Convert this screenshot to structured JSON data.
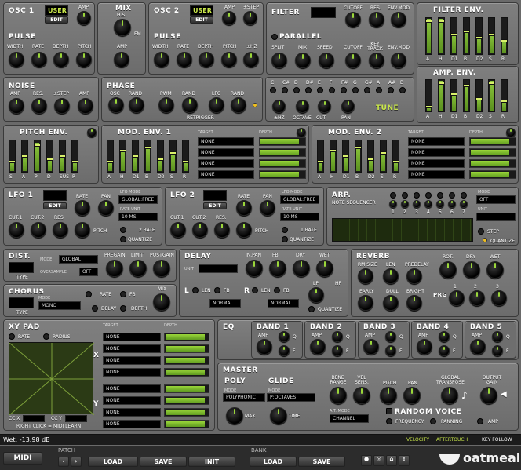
{
  "osc1": {
    "title": "OSC 1",
    "wave": "USER",
    "edit": "EDIT",
    "amp": "AMP",
    "pulse": "PULSE",
    "width": "WIDTH",
    "rate": "RATE",
    "depth": "DEPTH",
    "pitch": "PITCH"
  },
  "mix": {
    "title": "MIX",
    "hs": "H.S.",
    "fm": "FM",
    "amp": "AMP"
  },
  "osc2": {
    "title": "OSC 2",
    "wave": "USER",
    "edit": "EDIT",
    "amp": "AMP",
    "step": "±STEP",
    "pulse": "PULSE",
    "width": "WIDTH",
    "rate": "RATE",
    "depth": "DEPTH",
    "pitch": "PITCH",
    "hz": "±HZ"
  },
  "filter": {
    "title": "FILTER",
    "cutoff": "CUTOFF",
    "res": "RES.",
    "envmod": "ENV.MOD",
    "parallel": "PARALLEL",
    "split": "SPLIT",
    "mix": "MIX",
    "speed": "SPEED",
    "cutoff2": "CUTOFF",
    "keytrack": "KEY TRACK",
    "envmod2": "ENV.MOD"
  },
  "filterenv": {
    "title": "FILTER ENV.",
    "labels": [
      "A",
      "H",
      "D1",
      "B",
      "D2",
      "S",
      "R"
    ],
    "levels": [
      0.95,
      0.95,
      0.55,
      0.65,
      0.45,
      0.55,
      0.35
    ]
  },
  "ampenv": {
    "title": "AMP. ENV.",
    "labels": [
      "A",
      "H",
      "D1",
      "B",
      "D2",
      "S",
      "R"
    ],
    "levels": [
      0.1,
      0.95,
      0.55,
      0.85,
      0.4,
      0.95,
      0.3
    ]
  },
  "noise": {
    "title": "NOISE",
    "amp": "AMP",
    "res": "RES.",
    "step": "±STEP",
    "amp2": "AMP"
  },
  "phase": {
    "title": "PHASE",
    "osc": "OSC",
    "rand": "RAND",
    "pwm": "PWM",
    "rand2": "RAND",
    "lfo": "LFO",
    "rand3": "RAND",
    "retrigger": "RETRIGGER"
  },
  "tune": {
    "notes": [
      "C",
      "C#",
      "D",
      "D#",
      "E",
      "F",
      "F#",
      "G",
      "G#",
      "A",
      "A#",
      "B"
    ],
    "hz": "±HZ",
    "octave": "OCTAVE",
    "cut": "CUT",
    "pan": "PAN",
    "title": "TUNE"
  },
  "pitchenv": {
    "title": "PITCH ENV.",
    "labels": [
      "S",
      "A",
      "P",
      "D",
      "SUS",
      "R"
    ],
    "levels": [
      0.3,
      0.5,
      0.9,
      0.4,
      0.5,
      0.3
    ]
  },
  "modenv1": {
    "title": "MOD. ENV. 1",
    "target": "TARGET",
    "depth": "DEPTH",
    "labels": [
      "A",
      "H",
      "D1",
      "B",
      "D2",
      "S",
      "R"
    ],
    "levels": [
      0.3,
      0.7,
      0.5,
      0.8,
      0.4,
      0.6,
      0.3
    ],
    "rows": [
      "NONE",
      "NONE",
      "NONE",
      "NONE"
    ],
    "depths": [
      0.85,
      0.85,
      0.85,
      0.85
    ]
  },
  "modenv2": {
    "title": "MOD. ENV. 2",
    "target": "TARGET",
    "depth": "DEPTH",
    "labels": [
      "A",
      "H",
      "D1",
      "B",
      "D2",
      "S",
      "R"
    ],
    "levels": [
      0.3,
      0.7,
      0.5,
      0.8,
      0.4,
      0.6,
      0.3
    ],
    "rows": [
      "NONE",
      "NONE",
      "NONE",
      "NONE"
    ],
    "depths": [
      0.85,
      0.85,
      0.85,
      0.85
    ]
  },
  "lfo1": {
    "title": "LFO 1",
    "edit": "EDIT",
    "rate": "RATE",
    "pan": "PAN",
    "mode_l": "LFO MODE",
    "mode": "GLOBAL:FREE",
    "unit_l": "RATE UNIT",
    "unit": "10 MS",
    "cut1": "CUT.1",
    "cut2": "CUT.2",
    "res": "RES.",
    "pitch": "PITCH",
    "rate2": "2 RATE",
    "quantize": "QUANTIZE"
  },
  "lfo2": {
    "title": "LFO 2",
    "edit": "EDIT",
    "rate": "RATE",
    "pan": "PAN",
    "mode_l": "LFO MODE",
    "mode": "GLOBAL:FREE",
    "unit_l": "RATE UNIT",
    "unit": "10 MS",
    "cut1": "CUT.1",
    "cut2": "CUT.2",
    "res": "RES.",
    "pitch": "PITCH",
    "rate2": "1 RATE",
    "quantize": "QUANTIZE"
  },
  "arp": {
    "title": "ARP.",
    "seq": "NOTE SEQUENCER",
    "steps": [
      "1",
      "2",
      "3",
      "4",
      "5",
      "6",
      "7"
    ],
    "mode_l": "MODE",
    "mode": "OFF",
    "unit_l": "UNIT",
    "step": "STEP",
    "quantize": "QUANTIZE"
  },
  "dist": {
    "title": "DIST.",
    "mode_l": "MODE",
    "mode": "GLOBAL",
    "over_l": "OVERSAMPLE",
    "over": "OFF",
    "pregain": "PREGAIN",
    "limit": "LIMIT",
    "postgain": "POSTGAIN",
    "type": "TYPE"
  },
  "delay": {
    "title": "DELAY",
    "inpan": "IN.PAN",
    "fbl": "FB",
    "dry": "DRY",
    "wet": "WET",
    "unit": "UNIT",
    "l": "L",
    "r": "R",
    "len": "LEN",
    "fb": "FB",
    "seq": "NORMAL",
    "seq2": "NORMAL",
    "lp": "LP",
    "hp": "HP",
    "quantize": "QUANTIZE"
  },
  "reverb": {
    "title": "REVERB",
    "rmsize": "RM.SIZE",
    "len": "LEN",
    "predelay": "PREDELAY",
    "early": "EARLY",
    "dull": "DULL",
    "bright": "BRIGHT",
    "rot": "ROT.",
    "dry": "DRY",
    "wet": "WET",
    "prg": "PRG",
    "p1": "1",
    "p2": "2",
    "p3": "3"
  },
  "chorus": {
    "title": "CHORUS",
    "mode_l": "MODE",
    "mode": "MONO",
    "rate": "RATE",
    "fb": "FB",
    "delay": "DELAY",
    "depth": "DEPTH",
    "mix": "MIX",
    "type": "TYPE"
  },
  "xypad": {
    "title": "XY PAD",
    "rate": "RATE",
    "radius": "RADIUS",
    "target": "TARGET",
    "depth": "DEPTH",
    "x": "X",
    "y": "Y",
    "rows": [
      "NONE",
      "NONE",
      "NONE",
      "NONE",
      "NONE",
      "NONE",
      "NONE",
      "NONE"
    ],
    "ccx": "CC X",
    "ccy": "CC Y",
    "hint": "RIGHT CLICK = MIDI LEARN"
  },
  "eq": {
    "title": "EQ",
    "bands": [
      "BAND 1",
      "BAND 2",
      "BAND 3",
      "BAND 4",
      "BAND 5"
    ],
    "amp": "AMP",
    "q": "Q",
    "f": "F"
  },
  "master": {
    "title": "MASTER",
    "poly": "POLY",
    "glide": "GLIDE",
    "mode_l": "MODE",
    "mode": "POLYPHONIC",
    "mode2_l": "MODE",
    "mode2": "P:OCTAVES",
    "max": "MAX",
    "time": "TIME",
    "bend": "BEND RANGE",
    "vel": "VEL SENS.",
    "pitch": "PITCH",
    "pan": "PAN",
    "global": "GLOBAL TRANSPOSE",
    "out": "OUTPUT GAIN",
    "atmode_l": "A.T. MODE",
    "atmode": "CHANNEL",
    "random": "RANDOM VOICE",
    "freq": "FREQUENCY",
    "panning": "PANNING",
    "amp": "AMP"
  },
  "status": {
    "wet": "Wet: -13.98 dB",
    "velocity": "VELOCITY",
    "aftertouch": "AFTERTOUCH",
    "keyfollow": "KEY FOLLOW"
  },
  "footer": {
    "midi": "MIDI",
    "patch": "PATCH",
    "load": "LOAD",
    "save": "SAVE",
    "init": "INIT",
    "bank": "BANK",
    "load2": "LOAD",
    "save2": "SAVE",
    "brand": "oatmeal"
  }
}
